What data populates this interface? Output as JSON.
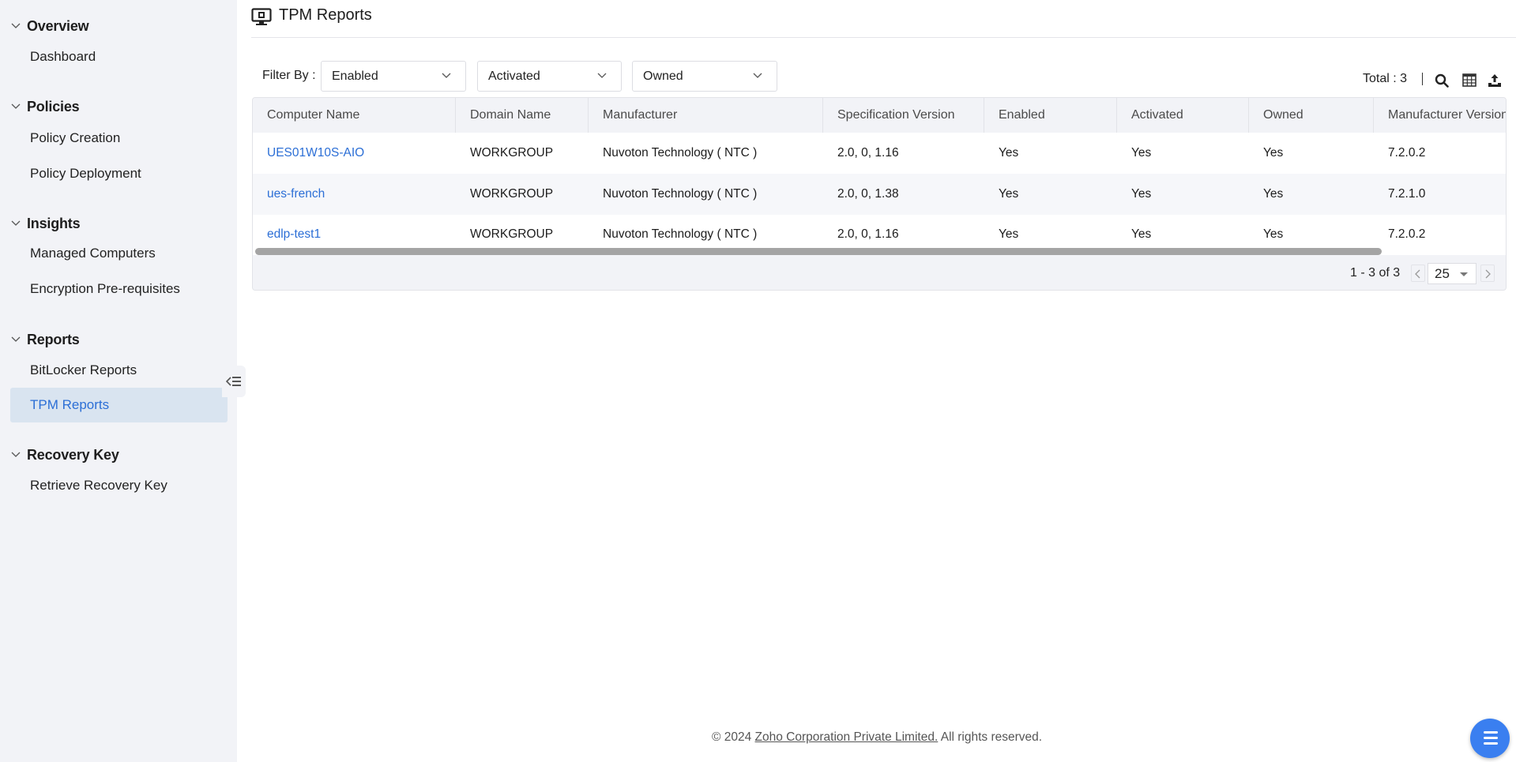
{
  "sidebar": {
    "sections": [
      {
        "title": "Overview",
        "items": [
          {
            "label": "Dashboard"
          }
        ]
      },
      {
        "title": "Policies",
        "items": [
          {
            "label": "Policy Creation"
          },
          {
            "label": "Policy Deployment"
          }
        ]
      },
      {
        "title": "Insights",
        "items": [
          {
            "label": "Managed Computers"
          },
          {
            "label": "Encryption Pre-requisites"
          }
        ]
      },
      {
        "title": "Reports",
        "items": [
          {
            "label": "BitLocker Reports"
          },
          {
            "label": "TPM Reports",
            "active": true
          }
        ]
      },
      {
        "title": "Recovery Key",
        "items": [
          {
            "label": "Retrieve Recovery Key"
          }
        ]
      }
    ],
    "collapse_icon": "collapse-sidebar-icon"
  },
  "header": {
    "icon": "monitor-chip-icon",
    "title": "TPM Reports"
  },
  "filters": {
    "label": "Filter By :",
    "dropdowns": [
      {
        "value": "Enabled"
      },
      {
        "value": "Activated"
      },
      {
        "value": "Owned"
      }
    ]
  },
  "toolbar": {
    "total_text": "Total : 3",
    "icons": [
      "search-icon",
      "column-chooser-icon",
      "export-icon"
    ]
  },
  "table": {
    "columns": [
      "Computer Name",
      "Domain Name",
      "Manufacturer",
      "Specification Version",
      "Enabled",
      "Activated",
      "Owned",
      "Manufacturer Version"
    ],
    "rows": [
      [
        "UES01W10S-AIO",
        "WORKGROUP",
        "Nuvoton Technology ( NTC )",
        "2.0, 0, 1.16",
        "Yes",
        "Yes",
        "Yes",
        "7.2.0.2"
      ],
      [
        "ues-french",
        "WORKGROUP",
        "Nuvoton Technology ( NTC )",
        "2.0, 0, 1.38",
        "Yes",
        "Yes",
        "Yes",
        "7.2.1.0"
      ],
      [
        "edlp-test1",
        "WORKGROUP",
        "Nuvoton Technology ( NTC )",
        "2.0, 0, 1.16",
        "Yes",
        "Yes",
        "Yes",
        "7.2.0.2"
      ]
    ]
  },
  "pagination": {
    "range_text": "1 - 3 of 3",
    "page_size": "25"
  },
  "footer": {
    "prefix": "© 2024 ",
    "link": "Zoho Corporation Private Limited.",
    "suffix": " All rights reserved."
  },
  "colors": {
    "accent": "#2c6fd6",
    "sidebar_bg": "#f2f3f7",
    "active_item_bg": "#d9e4f0",
    "fab": "#3a7ff0"
  }
}
